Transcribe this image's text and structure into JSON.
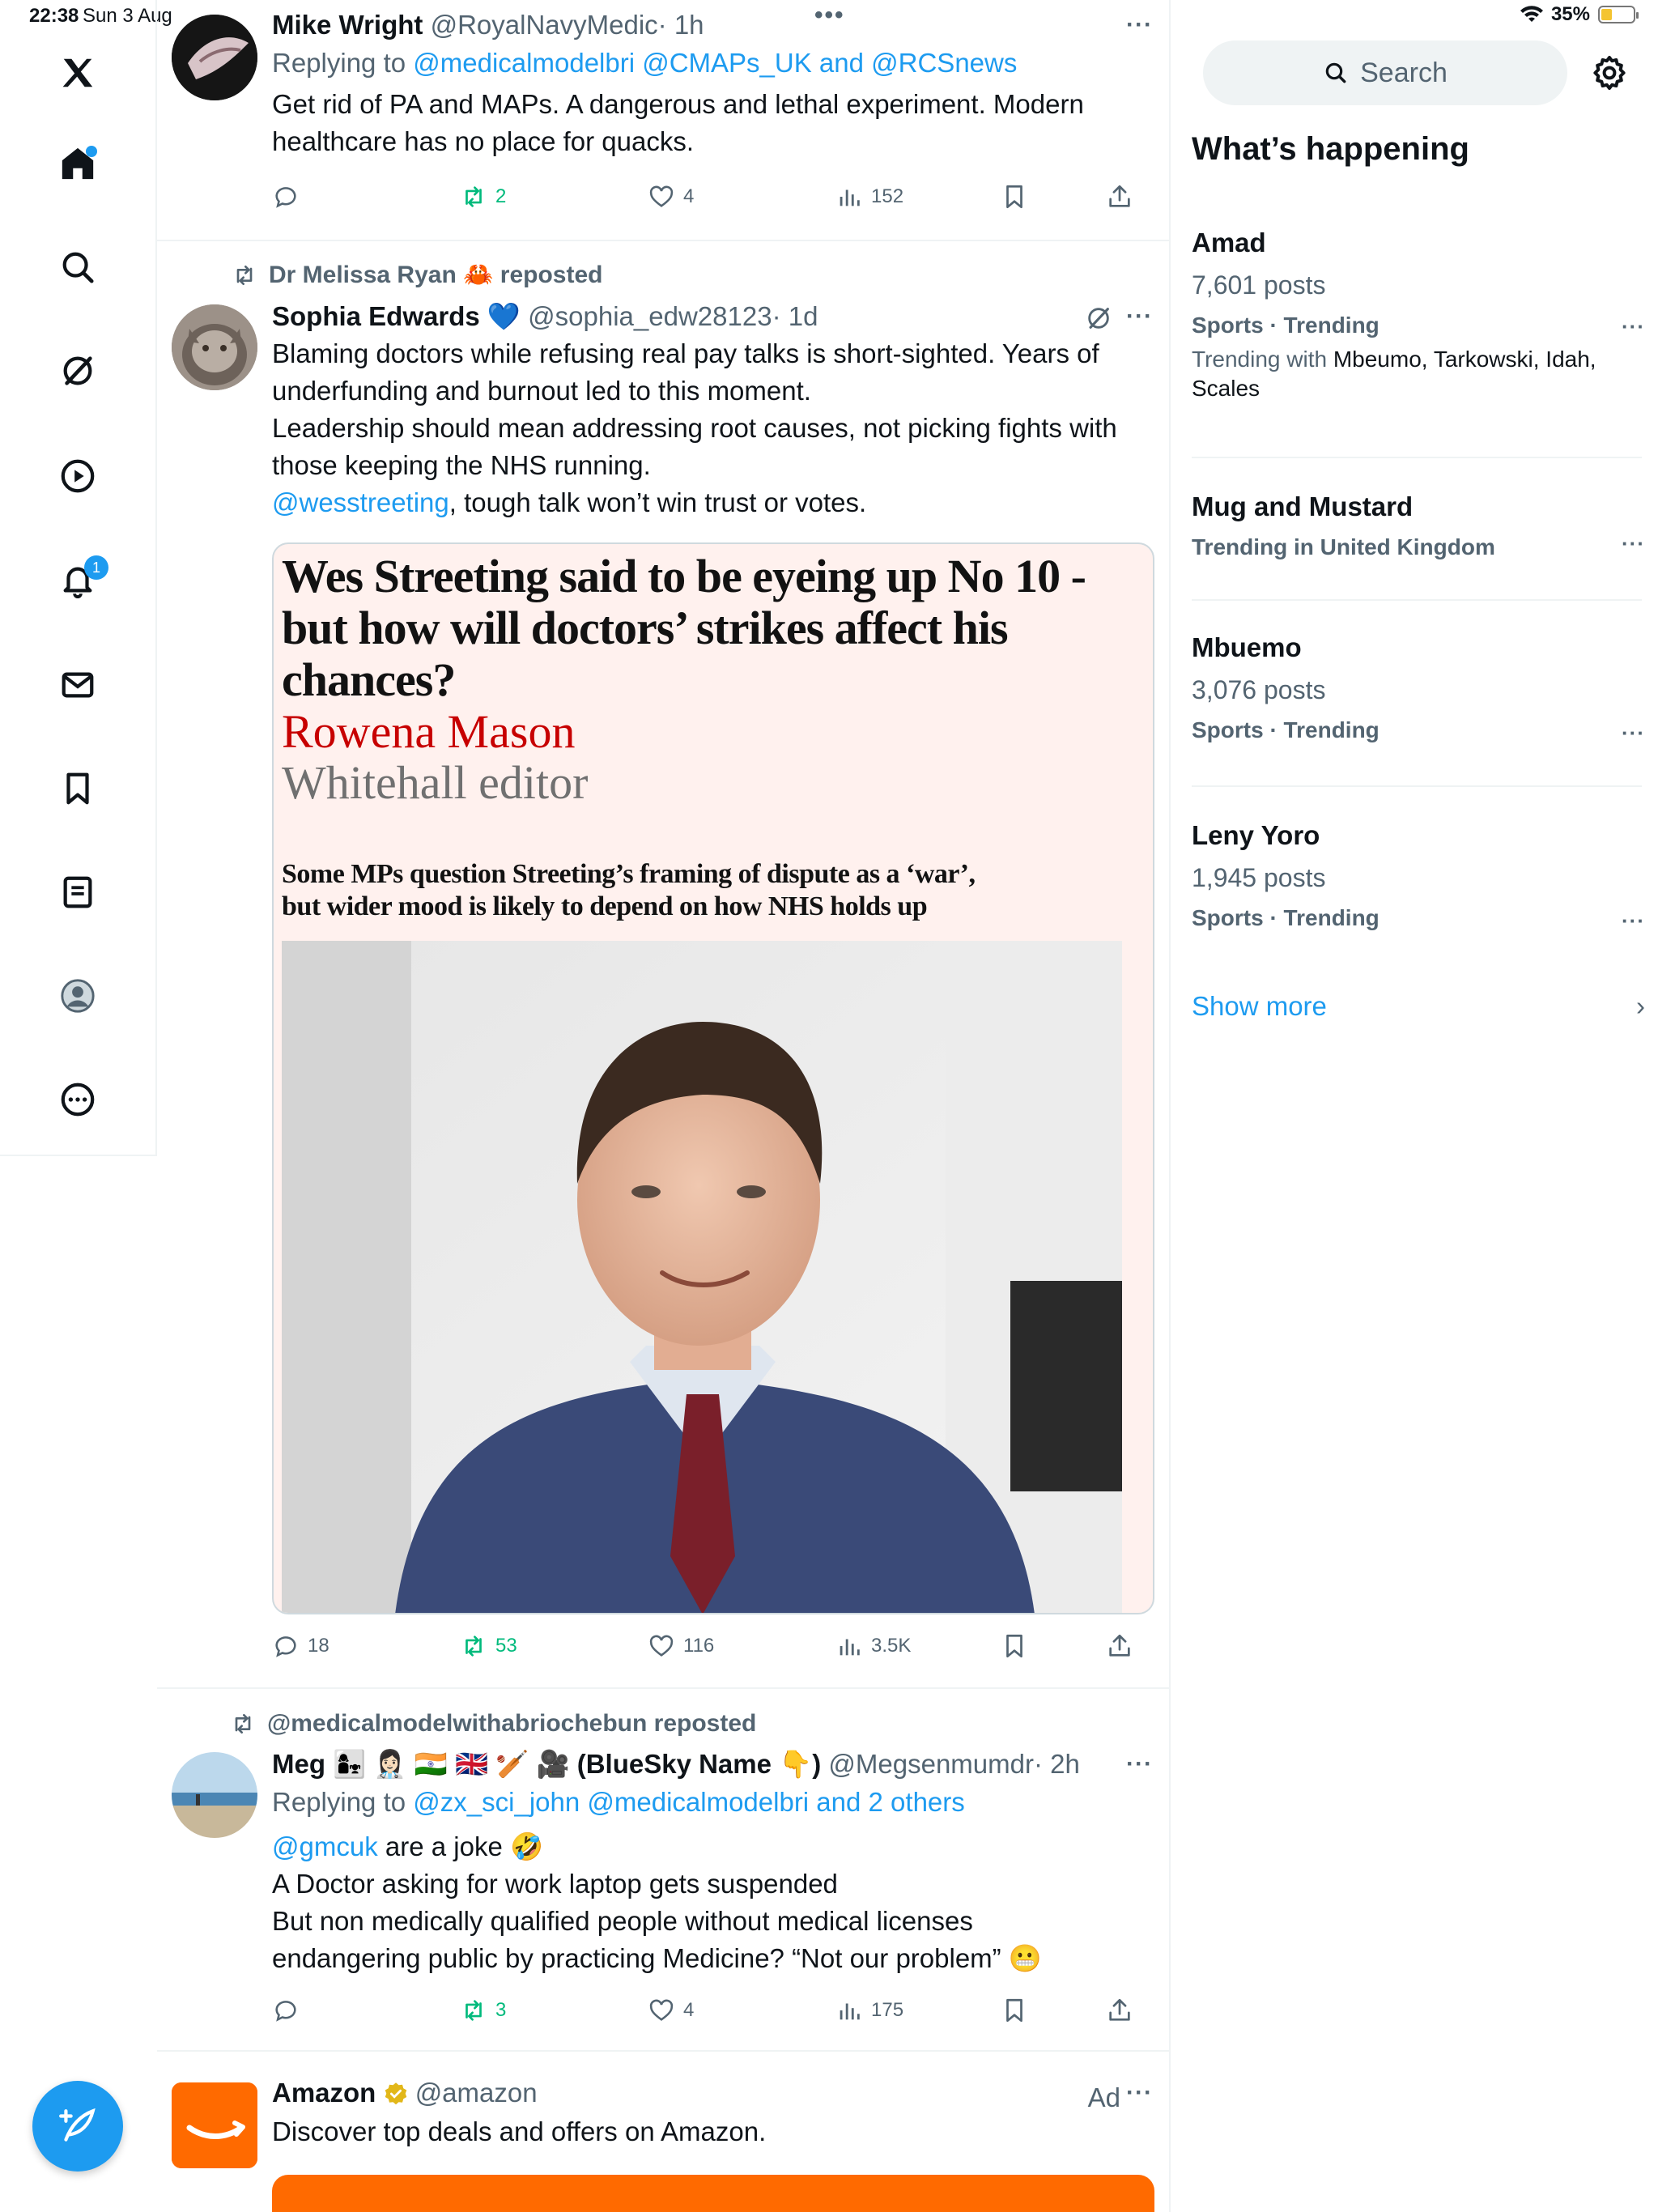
{
  "status_bar": {
    "time": "22:38",
    "date": "Sun 3 Aug",
    "battery": "35%"
  },
  "nav": {
    "items": [
      "Home",
      "Explore",
      "Grok",
      "Video",
      "Notifications",
      "Messages",
      "Bookmarks",
      "Lists",
      "Profile",
      "More"
    ],
    "notifications_badge": "1"
  },
  "tweets": [
    {
      "name": "Mike Wright",
      "handle": "@RoyalNavyMedic",
      "time": "· 1h",
      "replying_label": "Replying to",
      "replying_to": "@medicalmodelbri @CMAPs_UK and @RCSnews",
      "text_lines": [
        "Get rid of PA and MAPs. A dangerous and lethal experiment. Modern",
        "healthcare has no place for quacks."
      ],
      "replies": "",
      "reposts": "2",
      "likes": "4",
      "views": "152"
    },
    {
      "repost_by": "Dr Melissa Ryan 🦀 reposted",
      "name": "Sophia Edwards 💙",
      "handle": "@sophia_edw28123",
      "time": "· 1d",
      "text_lines": [
        "Blaming doctors while refusing real pay talks is short-sighted. Years of",
        "underfunding and burnout led to this moment.",
        "Leadership should mean addressing root causes, not picking fights with",
        "those keeping the NHS running."
      ],
      "mention": "@wesstreeting",
      "mention_rest": ", tough talk won’t win trust or votes.",
      "card": {
        "headline": "Wes Streeting said to be eyeing up No 10 - but how will doctors’ strikes affect his chances?",
        "author": "Rowena Mason",
        "role": "Whitehall editor",
        "standfirst_lines": [
          "Some MPs question Streeting’s framing of dispute as a ‘war’,",
          "but wider mood is likely to depend on how NHS holds up"
        ]
      },
      "replies": "18",
      "reposts": "53",
      "likes": "116",
      "views": "3.5K"
    },
    {
      "repost_by": "@medicalmodelwithabriochebun reposted",
      "name": "Meg 👩‍👧 👩🏻‍⚕️ 🇮🇳 🇬🇧 🏏 🎥 (BlueSky Name 👇)",
      "handle": "@Megsenmumdr",
      "time": "· 2h",
      "replying_label": "Replying to",
      "replying_to": "@zx_sci_john @medicalmodelbri and 2 others",
      "mention": "@gmcuk",
      "mention_rest": " are a joke 🤣",
      "text_lines": [
        "A Doctor asking for work laptop gets suspended",
        "But non medically qualified people without medical licenses",
        "endangering public by practicing Medicine? “Not our problem” 😬"
      ],
      "replies": "",
      "reposts": "3",
      "likes": "4",
      "views": "175"
    },
    {
      "name": "Amazon",
      "handle": "@amazon",
      "ad_label": "Ad",
      "text": "Discover top deals and offers on Amazon."
    }
  ],
  "sidebar": {
    "search_placeholder": "Search",
    "title": "What’s happening",
    "trends": [
      {
        "name": "Amad",
        "posts": "7,601 posts",
        "context": "Sports · Trending",
        "with_label": "Trending with",
        "with": "Mbeumo, Tarkowski, Idah,",
        "with2": "Scales"
      },
      {
        "name": "Mug and Mustard",
        "context": "Trending in United Kingdom"
      },
      {
        "name": "Mbuemo",
        "posts": "3,076 posts",
        "context": "Sports · Trending"
      },
      {
        "name": "Leny Yoro",
        "posts": "1,945 posts",
        "context": "Sports · Trending"
      }
    ],
    "show_more": "Show more"
  },
  "colors": {
    "accent": "#1d9bf0",
    "repost_green": "#00ba7c",
    "text_secondary": "#536471",
    "card_bg": "#fff1ee",
    "amazon_orange": "#ff6a00"
  }
}
